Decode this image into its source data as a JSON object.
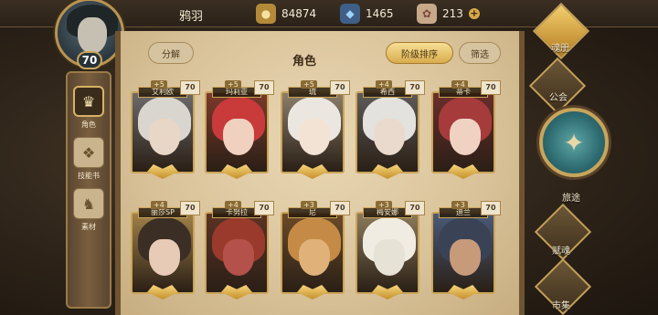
{
  "topbar": {
    "username": "鸦羽",
    "gold": "84874",
    "crystal": "1465",
    "energy": "213",
    "level": "70",
    "icons": [
      "gold-icon",
      "crystal-icon",
      "energy-icon",
      "plus-icon"
    ]
  },
  "leftnav": {
    "items": [
      {
        "label": "角色",
        "icon": "crown-icon"
      },
      {
        "label": "技能书",
        "icon": "book-icon"
      },
      {
        "label": "素材",
        "icon": "material-icon"
      }
    ]
  },
  "main": {
    "title": "角色",
    "split_label": "分解",
    "sort_label": "阶级排序",
    "filter_label": "筛选"
  },
  "cards": [
    {
      "name": "艾利欧",
      "plus": "+5",
      "level": "70",
      "hair": "#d9d6d0",
      "face": "#e8d6c6",
      "bg": "#6d6a6a"
    },
    {
      "name": "玛莉亚",
      "plus": "+5",
      "level": "70",
      "hair": "#c93a3a",
      "face": "#f0d1c0",
      "bg": "#7a3a2a"
    },
    {
      "name": "琉",
      "plus": "+5",
      "level": "70",
      "hair": "#ebe7e0",
      "face": "#f3e3d4",
      "bg": "#8b7e6a"
    },
    {
      "name": "希西",
      "plus": "+4",
      "level": "70",
      "hair": "#e4e2de",
      "face": "#e9dacd",
      "bg": "#5d5a58"
    },
    {
      "name": "蒂卡",
      "plus": "+4",
      "level": "70",
      "hair": "#a63b3b",
      "face": "#f0d2c2",
      "bg": "#6a2e2a"
    },
    {
      "name": "丽莎SP",
      "plus": "+4",
      "level": "70",
      "hair": "#3b2e25",
      "face": "#e8cbb6",
      "bg": "#a08048"
    },
    {
      "name": "卡努拉",
      "plus": "+4",
      "level": "70",
      "hair": "#9a3a2c",
      "face": "#b4514a",
      "bg": "#5a3326"
    },
    {
      "name": "尼",
      "plus": "+3",
      "level": "70",
      "hair": "#c58a45",
      "face": "#e0b27a",
      "bg": "#6b4a28"
    },
    {
      "name": "梅安娜",
      "plus": "+3",
      "level": "70",
      "hair": "#f0ece2",
      "face": "#e6e2d6",
      "bg": "#8b7a5a"
    },
    {
      "name": "迪兰",
      "plus": "+3",
      "level": "70",
      "hair": "#3a4256",
      "face": "#c79a7a",
      "bg": "#4b5a78"
    }
  ],
  "rightmenu": {
    "codex": "魂册",
    "guild": "公会",
    "journey": "旅途",
    "pray": "赋魂",
    "market": "市集"
  }
}
